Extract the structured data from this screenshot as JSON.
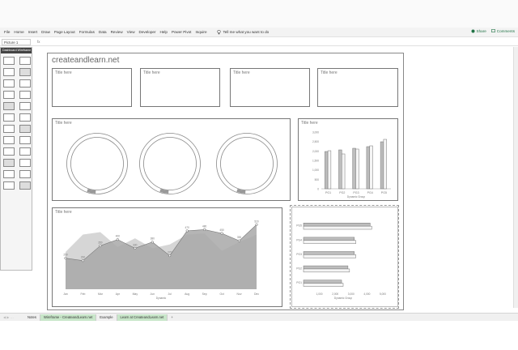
{
  "ribbon": {
    "tabs": [
      "File",
      "Home",
      "Insert",
      "Draw",
      "Page Layout",
      "Formulas",
      "Data",
      "Review",
      "View",
      "Developer",
      "Help",
      "Power Pivot",
      "Inquire"
    ],
    "tell_me": "Tell me what you want to do",
    "share": "Share",
    "comments": "Comments"
  },
  "formula_bar": {
    "name_box": "Picture 1",
    "fx": "fx"
  },
  "stencil": {
    "header": "Dashboard Wireframe"
  },
  "dashboard": {
    "brand": "createandlearn.net",
    "kpi_titles": [
      "Title here",
      "Title here",
      "Title here",
      "Title here"
    ],
    "donut_title": "Title here",
    "column_title": "Title here",
    "area_title": "Title here",
    "bar_title": "Title here"
  },
  "sheet_tabs": {
    "tabs": [
      "Notes",
      "Wireframe - CreateandLearn.net",
      "Example",
      "Learn at CreateandLearn.net"
    ],
    "add": "+"
  },
  "colors": {
    "excel_green": "#217346",
    "chart_gray": "#bdbdbd",
    "chart_dark": "#9e9e9e"
  },
  "chart_data": [
    {
      "type": "pie",
      "title": "Title here",
      "charts": 3,
      "values_each": [
        97,
        3
      ]
    },
    {
      "type": "bar",
      "title": "Title here",
      "categories": [
        "PG1",
        "PG2",
        "PG3",
        "PG4",
        "PG5"
      ],
      "series": [
        {
          "values": [
            230,
            240,
            250,
            260,
            290
          ]
        },
        {
          "values": [
            235,
            215,
            245,
            265,
            305
          ]
        }
      ],
      "ylim": [
        0,
        350
      ],
      "y_ticks": [
        "0",
        "500",
        "1,000",
        "1,500",
        "2,000",
        "2,500",
        "3,000"
      ],
      "xlabel": "Dynamic Group"
    },
    {
      "type": "area",
      "title": "Title here",
      "categories": [
        "Jan",
        "Feb",
        "Mar",
        "Apr",
        "May",
        "Jun",
        "Jul",
        "Aug",
        "Sep",
        "Oct",
        "Nov",
        "Dec"
      ],
      "series": [
        {
          "values": [
            300,
            440,
            460,
            340,
            410,
            330,
            360,
            440,
            450,
            310,
            380,
            440
          ]
        },
        {
          "values": [
            250,
            230,
            350,
            400,
            330,
            380,
            270,
            470,
            480,
            450,
            390,
            520
          ]
        }
      ],
      "line_labels": [
        "250",
        "230",
        "350",
        "400",
        "330",
        "380",
        "270",
        "470",
        "480",
        "450",
        "390",
        "520"
      ],
      "xlabel": "Dynamic",
      "ylim": [
        0,
        600
      ]
    },
    {
      "type": "bar",
      "orientation": "horizontal",
      "title": "Title here",
      "categories": [
        "PG5",
        "PG4",
        "PG3",
        "PG2",
        "PG1"
      ],
      "series": [
        {
          "values": [
            4200,
            3200,
            3200,
            2800,
            2400
          ]
        },
        {
          "values": [
            4300,
            3300,
            3300,
            2900,
            2500
          ]
        }
      ],
      "x_ticks": [
        "1,000",
        "2,000",
        "3,000",
        "4,000",
        "5,000"
      ],
      "xlabel": "Dynamic Group",
      "xlim": [
        0,
        5000
      ]
    }
  ]
}
